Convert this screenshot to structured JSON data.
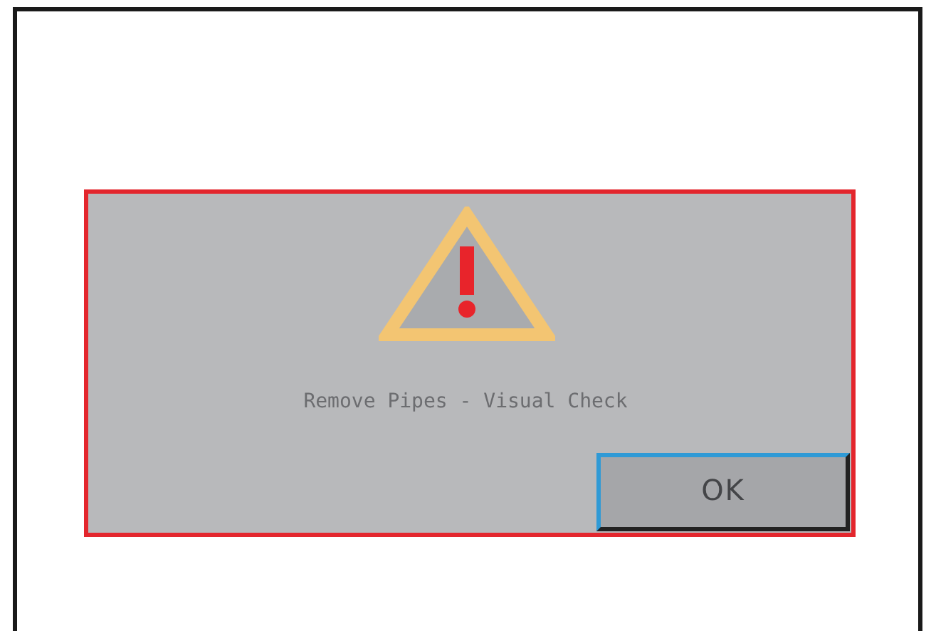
{
  "dialog": {
    "message": "Remove Pipes - Visual Check",
    "buttons": [
      {
        "label": "OK",
        "focused": true
      }
    ]
  }
}
